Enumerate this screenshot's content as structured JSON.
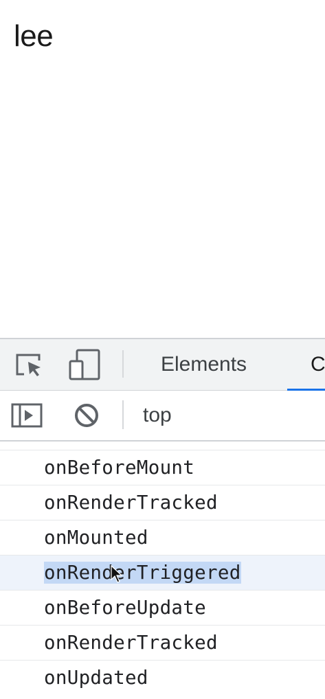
{
  "page": {
    "heading": "lee"
  },
  "devtools": {
    "tabs": [
      {
        "label": "Elements",
        "active": false
      },
      {
        "label": "C",
        "active": true
      }
    ],
    "icons": {
      "inspect": "inspect-element-icon",
      "device": "device-toolbar-icon",
      "sidebar": "show-sidebar-icon",
      "clear": "clear-console-icon"
    },
    "toolbar": {
      "context": "top"
    },
    "console": {
      "messages": [
        {
          "text": "onBeforeMount",
          "selected": false
        },
        {
          "text": "onRenderTracked",
          "selected": false
        },
        {
          "text": "onMounted",
          "selected": false
        },
        {
          "text": "onRenderTriggered",
          "selected": true
        },
        {
          "text": "onBeforeUpdate",
          "selected": false
        },
        {
          "text": "onRenderTracked",
          "selected": false
        },
        {
          "text": "onUpdated",
          "selected": false
        }
      ]
    },
    "colors": {
      "accent": "#1a73e8",
      "selection": "#c3d8f5",
      "selected_row": "#eef3fb"
    }
  }
}
